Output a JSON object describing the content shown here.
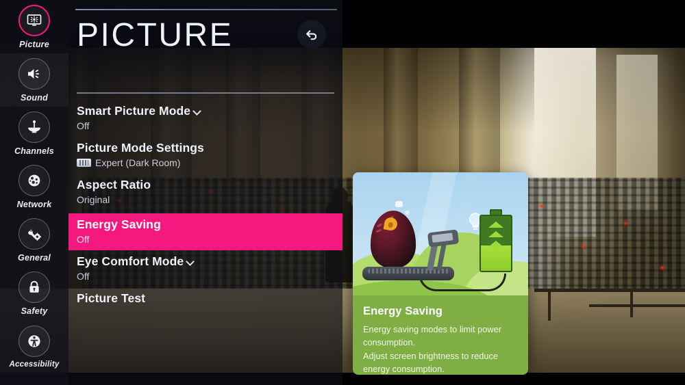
{
  "sidebar": {
    "items": [
      {
        "label": "Picture",
        "icon": "tv-picture-icon",
        "active": true,
        "dim": false
      },
      {
        "label": "Sound",
        "icon": "speaker-icon",
        "active": false,
        "dim": true
      },
      {
        "label": "Channels",
        "icon": "satellite-dish-icon",
        "active": false,
        "dim": false
      },
      {
        "label": "Network",
        "icon": "globe-network-icon",
        "active": false,
        "dim": false
      },
      {
        "label": "General",
        "icon": "wrench-gear-icon",
        "active": false,
        "dim": false
      },
      {
        "label": "Safety",
        "icon": "lock-icon",
        "active": false,
        "dim": false
      },
      {
        "label": "Accessibility",
        "icon": "accessibility-icon",
        "active": false,
        "dim": false
      }
    ]
  },
  "panel": {
    "title": "PICTURE",
    "back_icon": "back-arrow-icon",
    "items": [
      {
        "label": "Smart Picture Mode",
        "value": "Off",
        "chevron": true,
        "badge": false,
        "highlighted": false
      },
      {
        "label": "Picture Mode Settings",
        "value": "Expert (Dark Room)",
        "chevron": false,
        "badge": true,
        "highlighted": false
      },
      {
        "label": "Aspect Ratio",
        "value": "Original",
        "chevron": false,
        "badge": false,
        "highlighted": false
      },
      {
        "label": "Energy Saving",
        "value": "Off",
        "chevron": false,
        "badge": false,
        "highlighted": true
      },
      {
        "label": "Eye Comfort Mode",
        "value": "Off",
        "chevron": true,
        "badge": false,
        "highlighted": false
      },
      {
        "label": "Picture Test",
        "value": "",
        "chevron": false,
        "badge": false,
        "highlighted": false
      }
    ]
  },
  "card": {
    "title": "Energy Saving",
    "desc_line1": "Energy saving modes to limit power",
    "desc_line2": "consumption.",
    "desc_line3": "Adjust screen brightness to reduce",
    "desc_line4": "energy consumption.",
    "illustration": "bird-on-treadmill-powering-battery"
  },
  "colors": {
    "highlight_pink": "#f5187f",
    "card_green": "#7fae45",
    "panel_dark": "#0c0d14",
    "text_light": "#eef1fa"
  }
}
